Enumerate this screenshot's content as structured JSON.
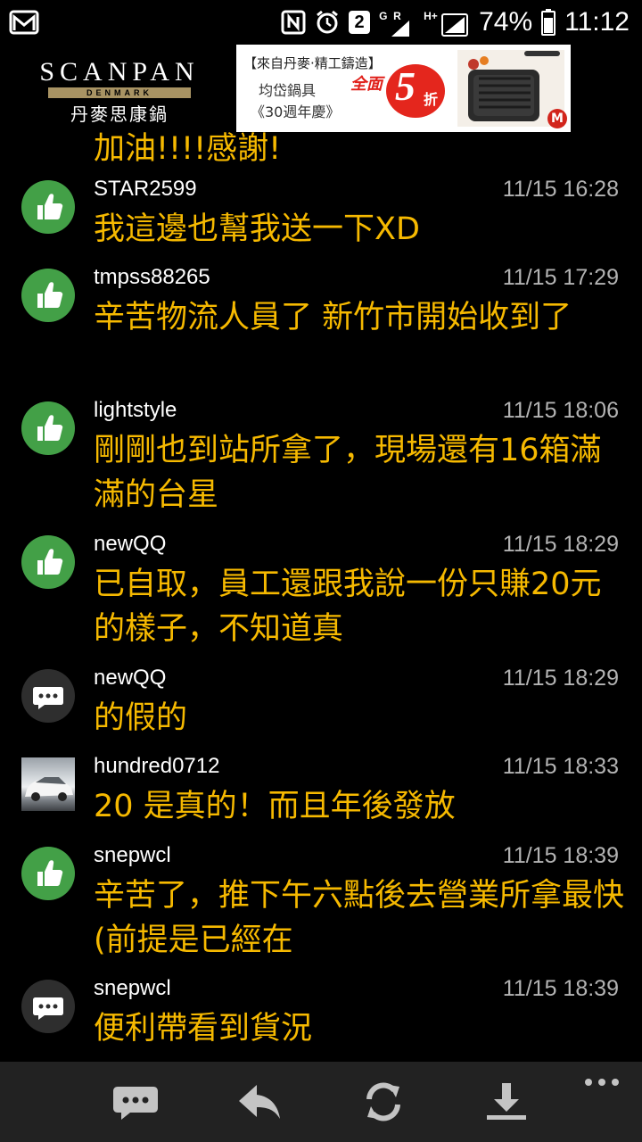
{
  "status_bar": {
    "battery": "74%",
    "time": "11:12",
    "notification_count": "2",
    "network_g": "G",
    "network_r": "R",
    "network_hplus": "H+",
    "icons": [
      "gmail-icon",
      "nfc-icon",
      "alarm-icon",
      "notification-count-icon",
      "signal-icon",
      "battery-icon"
    ]
  },
  "ad": {
    "brand": "SCANPAN",
    "brand_sub": "DENMARK",
    "brand_chinese": "丹麥思康鍋",
    "line1": "【來自丹麥‧精工鑄造】",
    "line2": "均岱鍋具",
    "line3": "《30週年慶》",
    "sale_prefix": "全面",
    "sale_number": "5",
    "sale_suffix": "折",
    "badge": "M"
  },
  "messages": [
    {
      "user": "",
      "time": "",
      "text": "加油!!!!感謝!",
      "avatar": "like-icon"
    },
    {
      "user": "STAR2599",
      "time": "11/15 16:28",
      "text": "我這邊也幫我送一下XD",
      "avatar": "like-icon"
    },
    {
      "user": "tmpss88265",
      "time": "11/15 17:29",
      "text": "辛苦物流人員了 新竹市開始收到了",
      "avatar": "like-icon"
    },
    {
      "user": "lightstyle",
      "time": "11/15 18:06",
      "text": "剛剛也到站所拿了，現場還有16箱滿滿的台星",
      "avatar": "like-icon"
    },
    {
      "user": "newQQ",
      "time": "11/15 18:29",
      "text": "已自取，員工還跟我說一份只賺20元的樣子，不知道真",
      "avatar": "like-icon"
    },
    {
      "user": "newQQ",
      "time": "11/15 18:29",
      "text": "的假的",
      "avatar": "chat-icon"
    },
    {
      "user": "hundred0712",
      "time": "11/15 18:33",
      "text": "20 是真的！而且年後發放",
      "avatar": "car-photo"
    },
    {
      "user": "snepwcl",
      "time": "11/15 18:39",
      "text": "辛苦了，推下午六點後去營業所拿最快(前提是已經在",
      "avatar": "like-icon"
    },
    {
      "user": "snepwcl",
      "time": "11/15 18:39",
      "text": "便利帶看到貨況",
      "avatar": "chat-icon"
    }
  ],
  "bottom_bar": {
    "buttons": [
      "comment-icon",
      "reply-icon",
      "refresh-icon",
      "download-icon",
      "more-icon"
    ]
  },
  "colors": {
    "background": "#000000",
    "message_text": "#f6b900",
    "like_avatar": "#43a047",
    "bottom_bar": "#222222"
  }
}
